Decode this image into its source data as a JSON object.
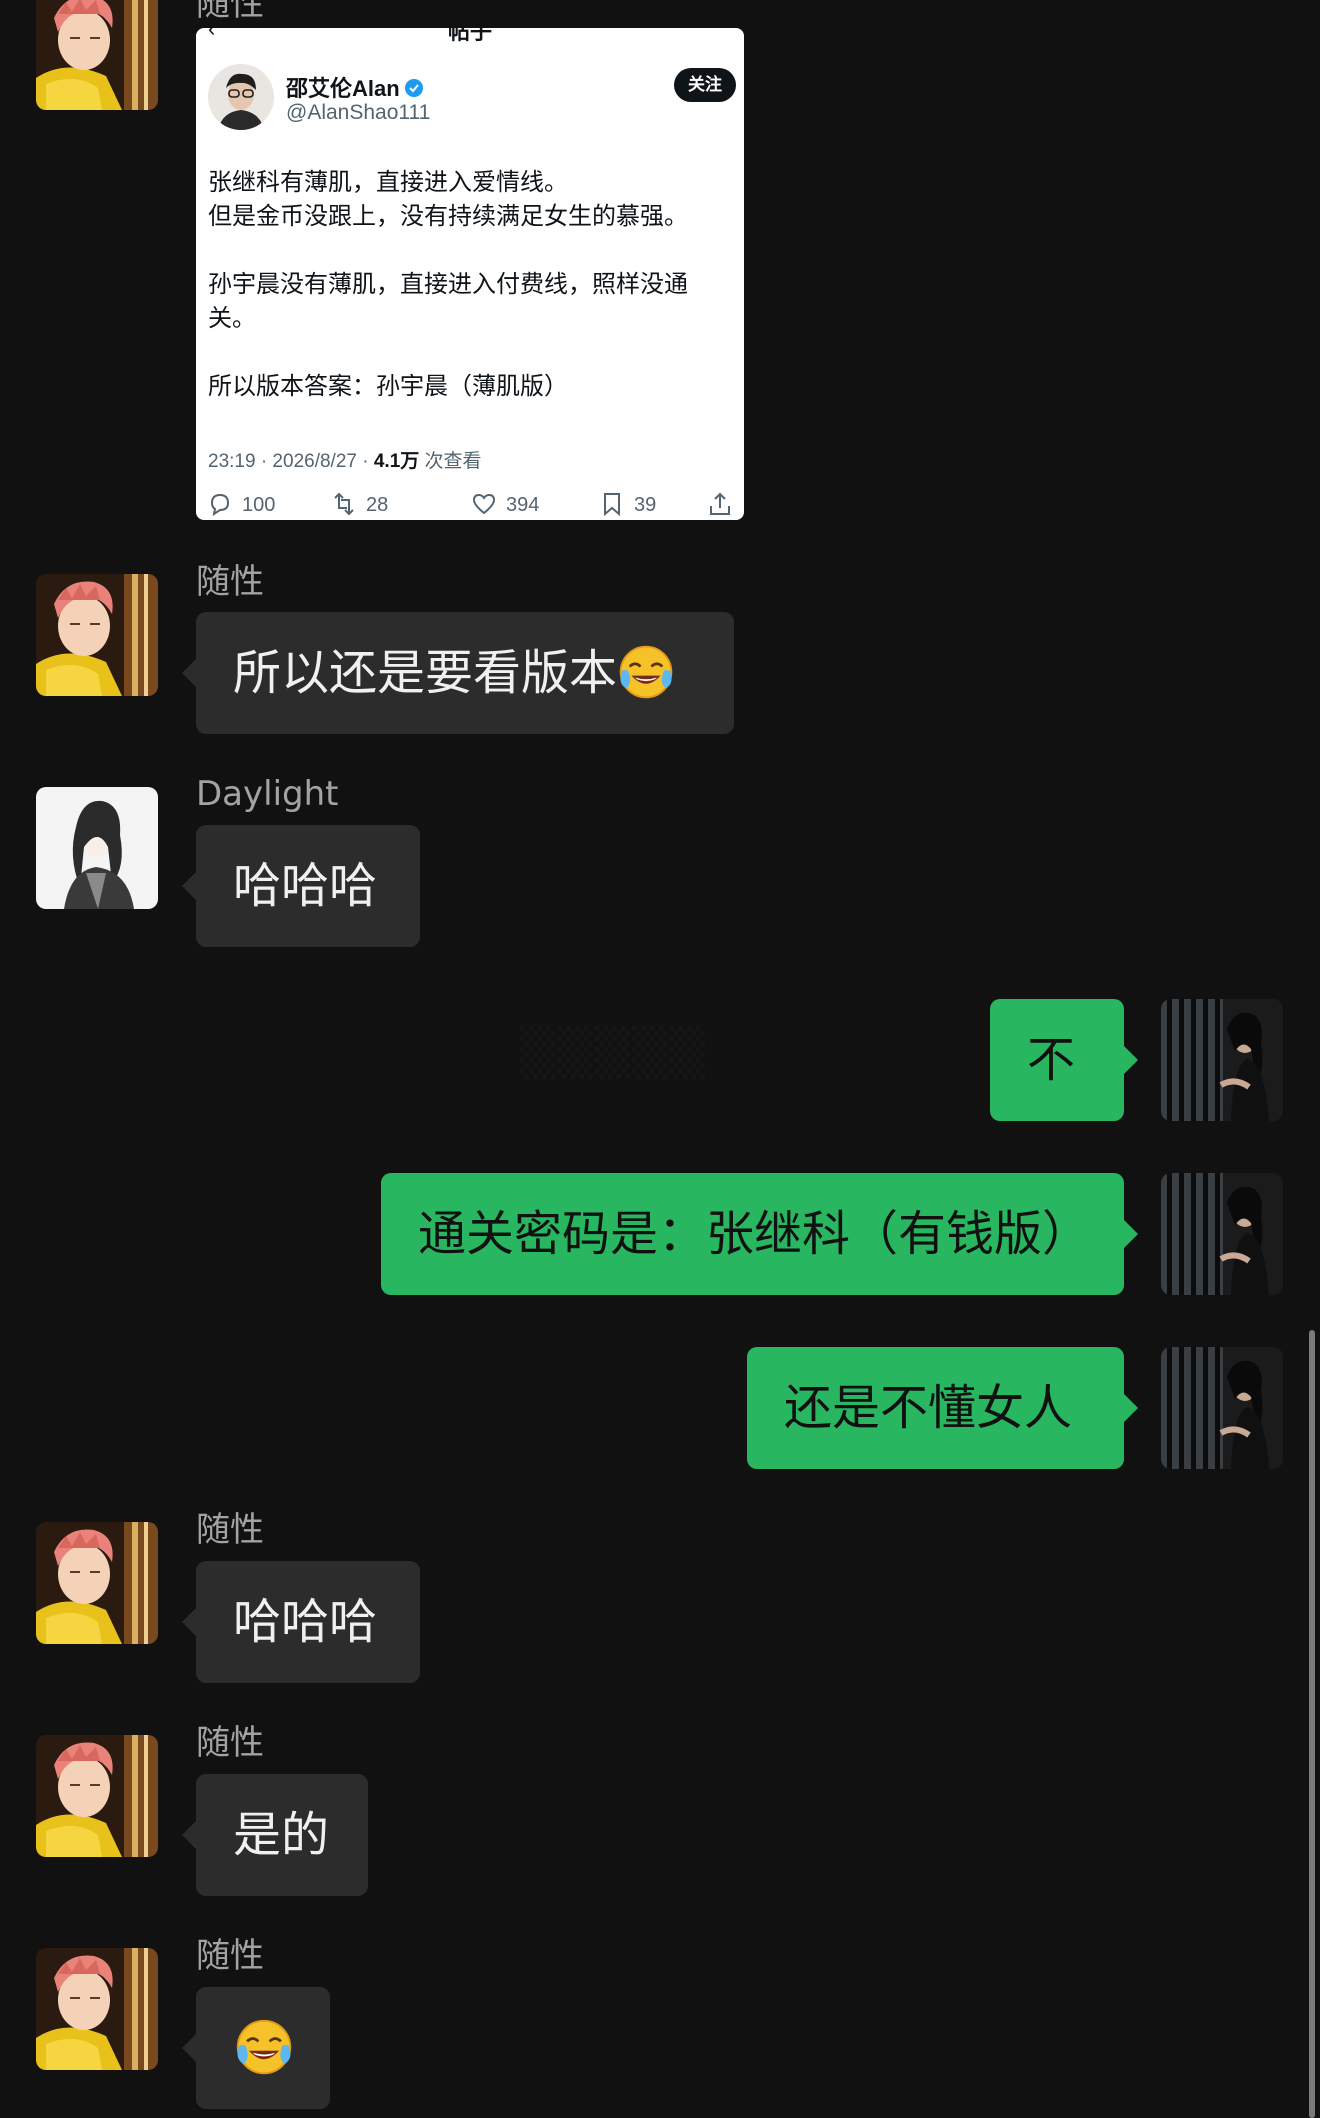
{
  "tweet": {
    "page_title": "帖子",
    "author_name": "邵艾伦Alan",
    "author_handle": "@AlanShao111",
    "follow_label": "关注",
    "lines": [
      "张继科有薄肌，直接进入爱情线。",
      "但是金币没跟上，没有持续满足女生的慕强。",
      "",
      "孙宇晨没有薄肌，直接进入付费线，照样没通",
      "关。",
      "",
      "所以版本答案：孙宇晨（薄肌版）"
    ],
    "time": "23:19 · 2026/8/27 · ",
    "views_count": "4.1万",
    "views_label": " 次查看",
    "replies": "100",
    "retweets": "28",
    "likes": "394",
    "bookmarks": "39"
  },
  "messages": [
    {
      "sender": "随性",
      "text": "所以还是要看版本",
      "emoji": "crying-laughing"
    },
    {
      "sender": "Daylight",
      "text": "哈哈哈"
    },
    {
      "text": "不"
    },
    {
      "text": "通关密码是：张继科（有钱版）"
    },
    {
      "text": "还是不懂女人"
    },
    {
      "sender": "随性",
      "text": "哈哈哈"
    },
    {
      "sender": "随性",
      "text": "是的"
    },
    {
      "sender": "随性",
      "text": "",
      "emoji": "crying-laughing"
    }
  ],
  "top_sender": "随性",
  "colors": {
    "background": "#111111",
    "incoming_bubble": "#2c2c2c",
    "outgoing_bubble": "#28b661"
  }
}
